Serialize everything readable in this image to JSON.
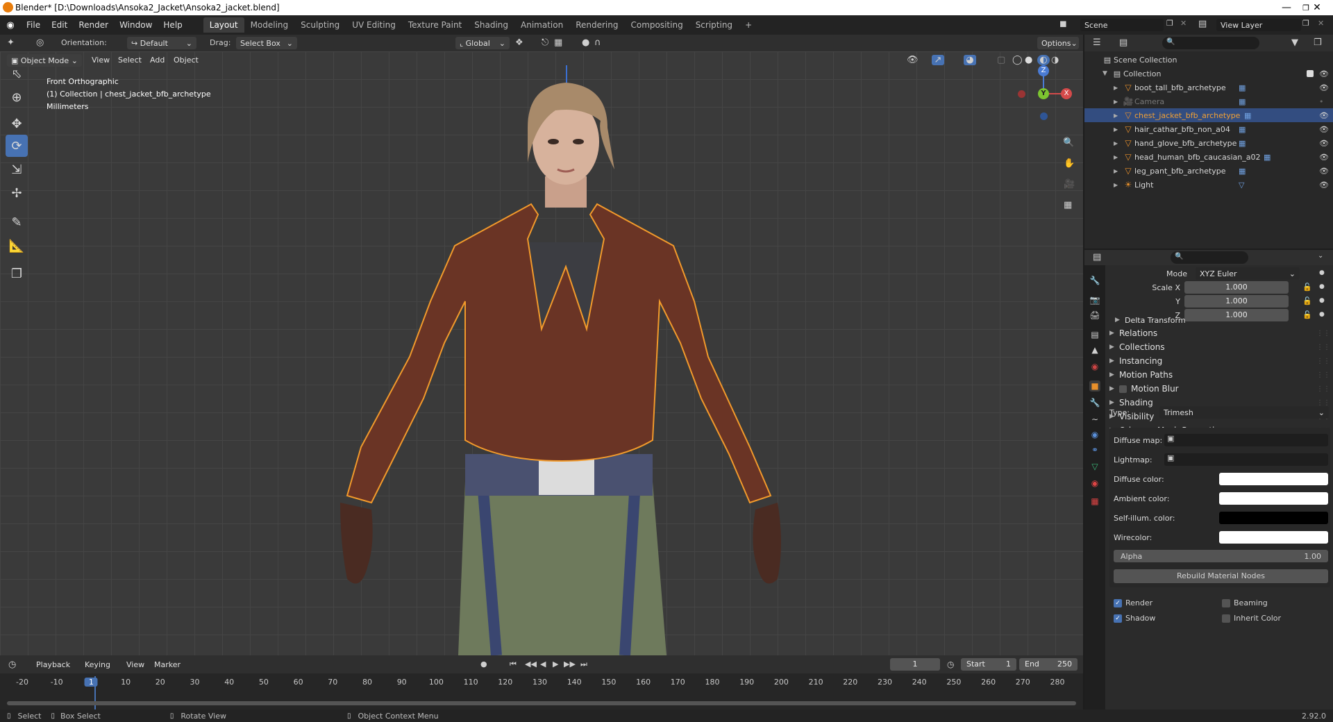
{
  "window": {
    "title": "Blender* [D:\\Downloads\\Ansoka2_Jacket\\Ansoka2_jacket.blend]"
  },
  "menu": [
    "File",
    "Edit",
    "Render",
    "Window",
    "Help"
  ],
  "workspaces": [
    "Layout",
    "Modeling",
    "Sculpting",
    "UV Editing",
    "Texture Paint",
    "Shading",
    "Animation",
    "Rendering",
    "Compositing",
    "Scripting"
  ],
  "workspace_add": "+",
  "scene": {
    "label": "Scene",
    "view_layer": "View Layer"
  },
  "tool_header": {
    "orientation_label": "Orientation:",
    "orientation_value": "Default",
    "drag_label": "Drag:",
    "drag_value": "Select Box",
    "transform_orientation": "Global",
    "options": "Options"
  },
  "viewport_header": {
    "mode": "Object Mode",
    "menus": [
      "View",
      "Select",
      "Add",
      "Object"
    ]
  },
  "viewport": {
    "overlay_line1": "Front Orthographic",
    "overlay_line2": "(1) Collection | chest_jacket_bfb_archetype",
    "overlay_line3": "Millimeters",
    "gizmo_z": "Z",
    "gizmo_y": "Y",
    "gizmo_x": "X"
  },
  "outliner": {
    "root": "Scene Collection",
    "collection": "Collection",
    "items": [
      {
        "name": "boot_tall_bfb_archetype",
        "selected": false,
        "dim": false
      },
      {
        "name": "Camera",
        "selected": false,
        "dim": true
      },
      {
        "name": "chest_jacket_bfb_archetype",
        "selected": true,
        "dim": false
      },
      {
        "name": "hair_cathar_bfb_non_a04",
        "selected": false,
        "dim": false
      },
      {
        "name": "hand_glove_bfb_archetype",
        "selected": false,
        "dim": false
      },
      {
        "name": "head_human_bfb_caucasian_a02",
        "selected": false,
        "dim": false
      },
      {
        "name": "leg_pant_bfb_archetype",
        "selected": false,
        "dim": false
      },
      {
        "name": "Light",
        "selected": false,
        "dim": false
      }
    ]
  },
  "properties": {
    "mode_label": "Mode",
    "mode_value": "XYZ Euler",
    "scale": [
      {
        "label": "Scale X",
        "value": "1.000"
      },
      {
        "label": "Y",
        "value": "1.000"
      },
      {
        "label": "Z",
        "value": "1.000"
      }
    ],
    "delta_transform": "Delta Transform",
    "panels": [
      "Relations",
      "Collections",
      "Instancing",
      "Motion Paths",
      "Motion Blur",
      "Shading",
      "Visibility",
      "Odyssey Mesh Properties"
    ],
    "type_label": "Type:",
    "type_value": "Trimesh",
    "diffuse_map_label": "Diffuse map:",
    "lightmap_label": "Lightmap:",
    "diffuse_color_label": "Diffuse color:",
    "ambient_color_label": "Ambient color:",
    "selfillum_label": "Self-illum. color:",
    "wirecolor_label": "Wirecolor:",
    "alpha_label": "Alpha",
    "alpha_value": "1.00",
    "rebuild_button": "Rebuild Material Nodes",
    "render_label": "Render",
    "shadow_label": "Shadow",
    "beaming_label": "Beaming",
    "inherit_color_label": "Inherit Color",
    "colors": {
      "diffuse": "#ffffff",
      "ambient": "#ffffff",
      "selfillum": "#000000",
      "wire": "#ffffff"
    }
  },
  "timeline": {
    "menus": [
      "Playback",
      "Keying",
      "View",
      "Marker"
    ],
    "current_frame": "1",
    "start_label": "Start",
    "start_value": "1",
    "end_label": "End",
    "end_value": "250",
    "ticks": [
      "-20",
      "-10",
      "1",
      "10",
      "20",
      "30",
      "40",
      "50",
      "60",
      "70",
      "80",
      "90",
      "100",
      "110",
      "120",
      "130",
      "140",
      "150",
      "160",
      "170",
      "180",
      "190",
      "200",
      "210",
      "220",
      "230",
      "240",
      "250",
      "260",
      "270",
      "280"
    ]
  },
  "statusbar": {
    "select": "Select",
    "box_select": "Box Select",
    "rotate_view": "Rotate View",
    "context_menu": "Object Context Menu",
    "version": "2.92.0"
  }
}
